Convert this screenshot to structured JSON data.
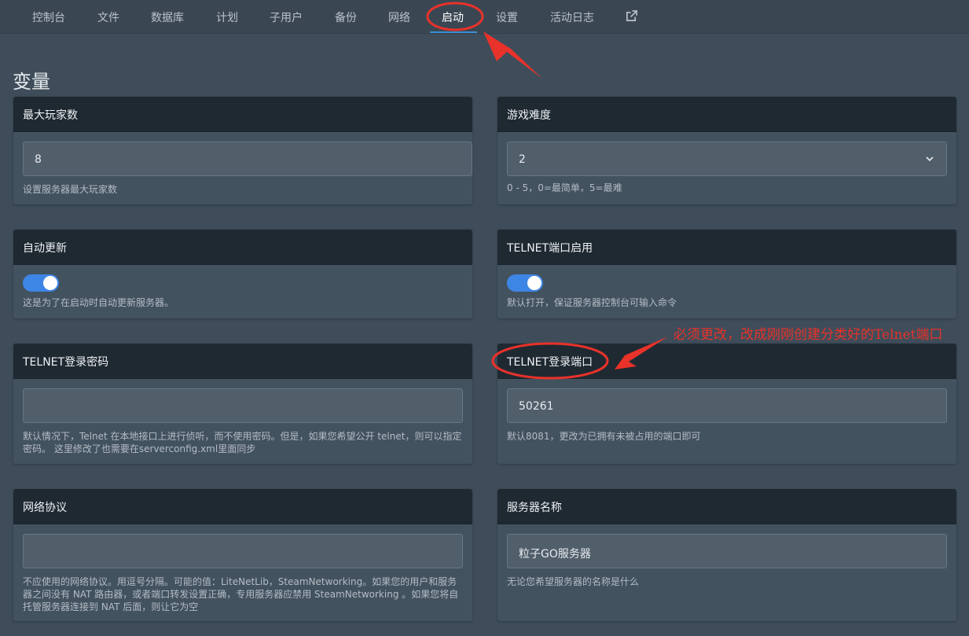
{
  "nav": {
    "items": [
      {
        "label": "控制台"
      },
      {
        "label": "文件"
      },
      {
        "label": "数据库"
      },
      {
        "label": "计划"
      },
      {
        "label": "子用户"
      },
      {
        "label": "备份"
      },
      {
        "label": "网络"
      },
      {
        "label": "启动"
      },
      {
        "label": "设置"
      },
      {
        "label": "活动日志"
      }
    ],
    "active_index": 7,
    "external_icon": "external-link-icon"
  },
  "page": {
    "title": "变量"
  },
  "cards": {
    "max_players": {
      "title": "最大玩家数",
      "value": "8",
      "help": "设置服务器最大玩家数"
    },
    "difficulty": {
      "title": "游戏难度",
      "value": "2",
      "help": "0 - 5，0=最简单，5=最难",
      "icon": "chevron-down-icon"
    },
    "auto_update": {
      "title": "自动更新",
      "enabled": true,
      "help": "这是为了在启动时自动更新服务器。"
    },
    "telnet_enabled": {
      "title": "TELNET端口启用",
      "enabled": true,
      "help": "默认打开，保证服务器控制台可输入命令"
    },
    "telnet_password": {
      "title": "TELNET登录密码",
      "value": "",
      "help": "默认情况下，Telnet 在本地接口上进行侦听，而不使用密码。但是，如果您希望公开 telnet，则可以指定密码。 这里修改了也需要在serverconfig.xml里面同步"
    },
    "telnet_port": {
      "title": "TELNET登录端口",
      "value": "50261",
      "help": "默认8081，更改为已拥有未被占用的端口即可"
    },
    "network_protocol": {
      "title": "网络协议",
      "value": "",
      "help": "不应使用的网络协议。用逗号分隔。可能的值：LiteNetLib，SteamNetworking。如果您的用户和服务器之间没有 NAT 路由器，或者端口转发设置正确，专用服务器应禁用 SteamNetworking 。如果您将自托管服务器连接到 NAT 后面，则让它为空"
    },
    "server_name": {
      "title": "服务器名称",
      "value": "粒子GO服务器",
      "help": "无论您希望服务器的名称是什么"
    }
  },
  "annotations": {
    "note": "必须更改，改成刚刚创建分类好的Telnet端口",
    "color": "#e8322a"
  },
  "colors": {
    "accent": "#3e86e6",
    "card_header": "#1f2932",
    "background": "#3f4d5a"
  }
}
